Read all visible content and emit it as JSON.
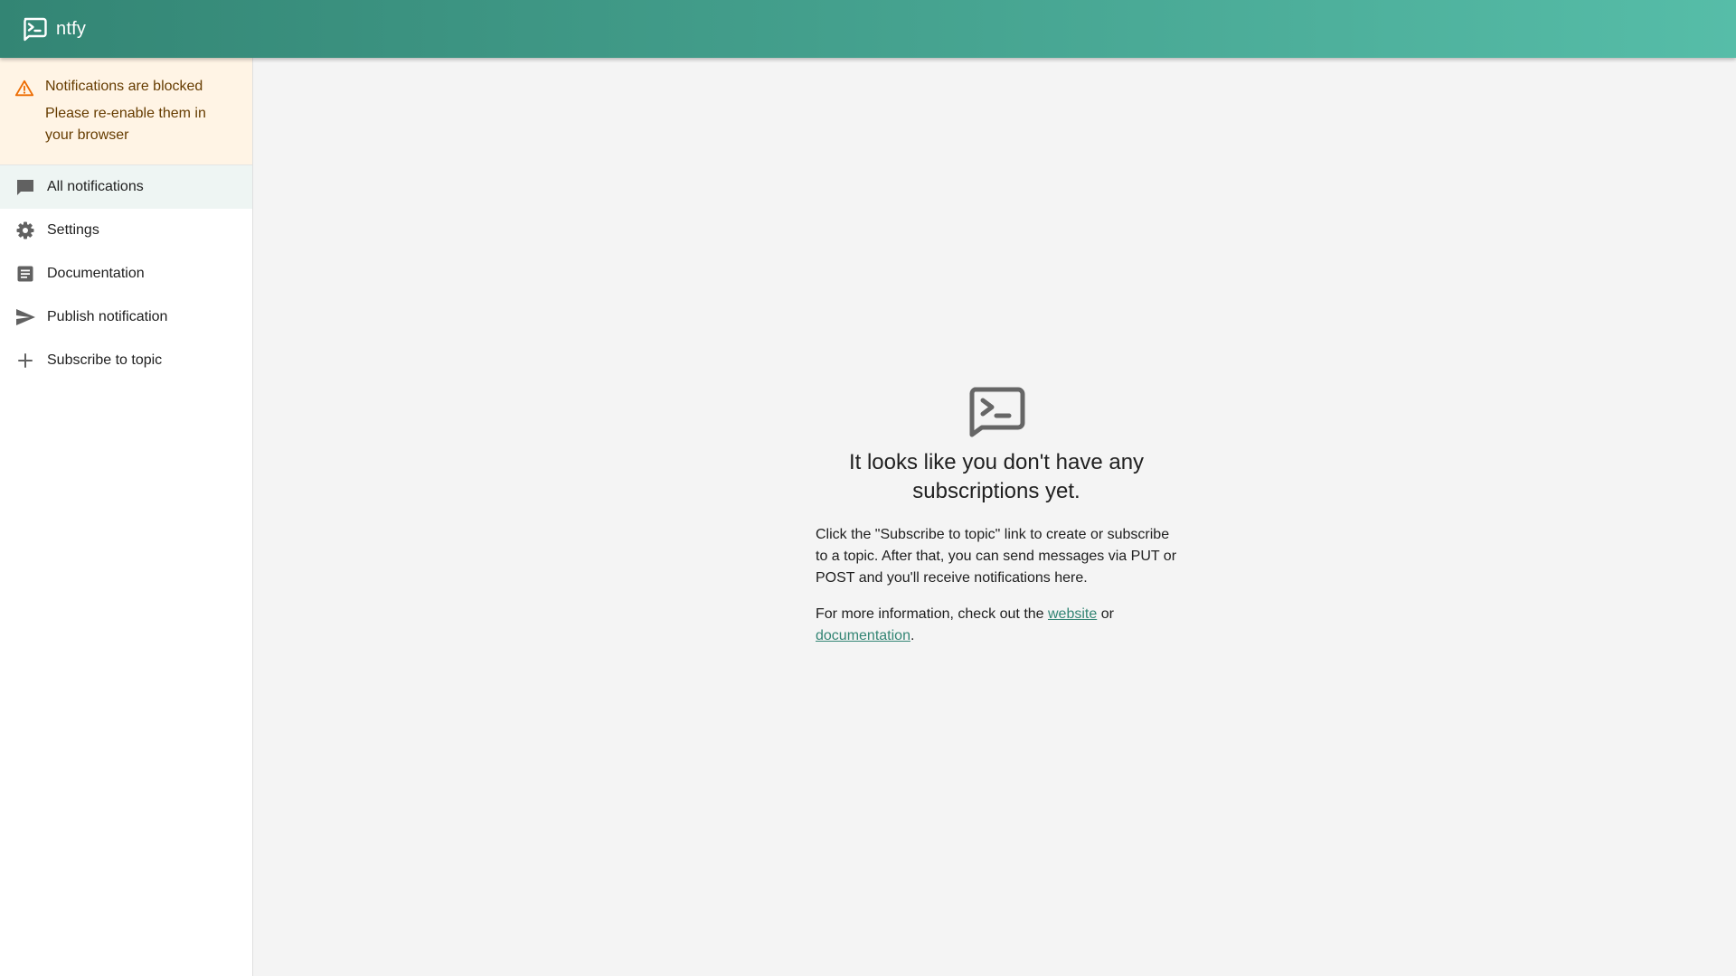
{
  "app": {
    "title": "ntfy"
  },
  "alert": {
    "title": "Notifications are blocked",
    "body": "Please re-enable them in your browser",
    "icon": "warning-icon",
    "color": "#ed6c02"
  },
  "sidebar": {
    "items": [
      {
        "label": "All notifications",
        "icon": "chat-icon",
        "selected": true
      },
      {
        "label": "Settings",
        "icon": "gear-icon",
        "selected": false
      },
      {
        "label": "Documentation",
        "icon": "article-icon",
        "selected": false
      },
      {
        "label": "Publish notification",
        "icon": "send-icon",
        "selected": false
      },
      {
        "label": "Subscribe to topic",
        "icon": "plus-icon",
        "selected": false
      }
    ]
  },
  "empty_state": {
    "title": "It looks like you don't have any subscriptions yet.",
    "instructions": "Click the \"Subscribe to topic\" link to create or subscribe to a topic. After that, you can send messages via PUT or POST and you'll receive notifications here.",
    "info_prefix": "For more information, check out the ",
    "website_link": "website",
    "info_middle": " or ",
    "documentation_link": "documentation",
    "info_suffix": "."
  },
  "colors": {
    "brand": "#338574",
    "brand_light": "#56bda8",
    "alert_background": "#fff4e5",
    "alert_text": "#663c00"
  }
}
